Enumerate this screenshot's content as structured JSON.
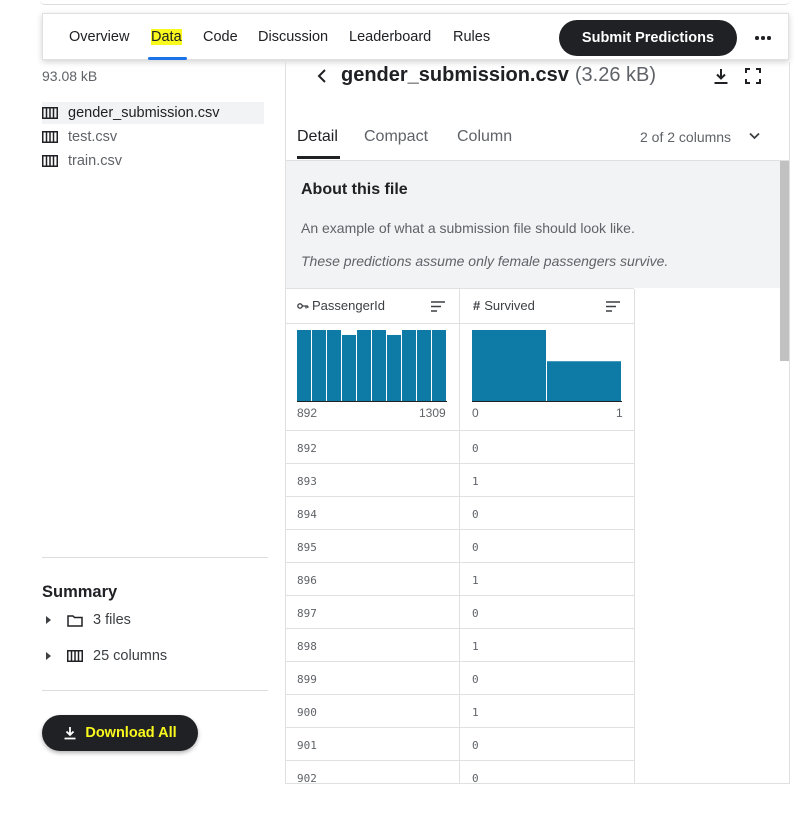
{
  "nav": {
    "items": [
      "Overview",
      "Data",
      "Code",
      "Discussion",
      "Leaderboard",
      "Rules"
    ],
    "active": "Data",
    "submit_label": "Submit Predictions"
  },
  "sidebar": {
    "total_size": "93.08 kB",
    "files": [
      {
        "name": "gender_submission.csv",
        "selected": true
      },
      {
        "name": "test.csv",
        "selected": false
      },
      {
        "name": "train.csv",
        "selected": false
      }
    ],
    "summary_title": "Summary",
    "summary_items": [
      "3 files",
      "25 columns"
    ],
    "download_label": "Download All"
  },
  "file": {
    "name": "gender_submission.csv",
    "size": "(3.26 kB)",
    "tabs": [
      "Detail",
      "Compact",
      "Column"
    ],
    "active_tab": "Detail",
    "columns_count": "2 of 2 columns",
    "about_title": "About this file",
    "about_desc": "An example of what a submission file should look like.",
    "about_note": "These predictions assume only female passengers survive."
  },
  "columns": [
    {
      "name": "PassengerId",
      "type_icon": "key-icon",
      "hist_min": "892",
      "hist_max": "1309",
      "hist_bins": [
        1.0,
        1.0,
        1.0,
        0.93,
        1.0,
        1.0,
        0.93,
        1.0,
        1.0,
        1.0
      ]
    },
    {
      "name": "Survived",
      "type_icon": "hash-icon",
      "hist_min": "0",
      "hist_max": "1",
      "hist_bins": [
        1.0,
        0.56
      ]
    }
  ],
  "rows": [
    [
      "892",
      "0"
    ],
    [
      "893",
      "1"
    ],
    [
      "894",
      "0"
    ],
    [
      "895",
      "0"
    ],
    [
      "896",
      "1"
    ],
    [
      "897",
      "0"
    ],
    [
      "898",
      "1"
    ],
    [
      "899",
      "0"
    ],
    [
      "900",
      "1"
    ],
    [
      "901",
      "0"
    ],
    [
      "902",
      "0"
    ]
  ],
  "colors": {
    "accent_bar": "#0e7ba7",
    "highlight": "#f9f91e",
    "dark": "#202124"
  }
}
